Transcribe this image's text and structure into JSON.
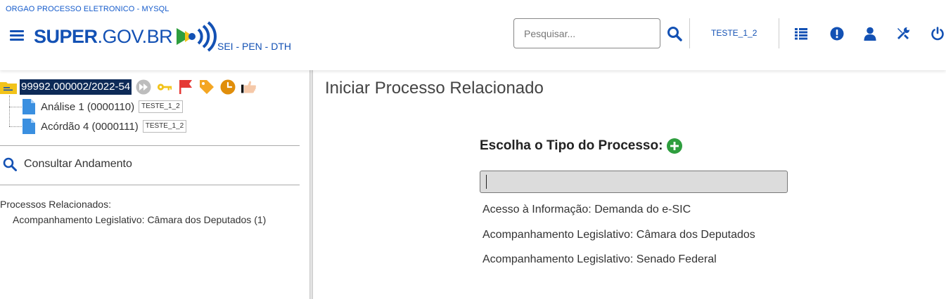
{
  "header": {
    "org_line": "ORGAO PROCESSO ELETRONICO - MYSQL",
    "logo_bold": "SUPER",
    "logo_rest": ".GOV.BR",
    "logo_sub": "SEI - PEN - DTH",
    "search_placeholder": "Pesquisar...",
    "unit": "TESTE_1_2",
    "icons": [
      "menu-icon",
      "search-icon",
      "panel-list-icon",
      "alert-icon",
      "user-icon",
      "tools-icon",
      "power-icon"
    ]
  },
  "tree": {
    "process_number": "99992.000002/2022-54",
    "status_icons": [
      "fast-forward-icon",
      "key-icon",
      "flag-icon",
      "tag-icon",
      "clock-icon",
      "hand-icon"
    ],
    "documents": [
      {
        "label": "Análise 1 (0000110)",
        "tag": "TESTE_1_2"
      },
      {
        "label": "Acórdão 4 (0000111)",
        "tag": "TESTE_1_2"
      }
    ]
  },
  "sidebar": {
    "consult_label": "Consultar Andamento",
    "related_title": "Processos Relacionados:",
    "related_items": [
      "Acompanhamento Legislativo: Câmara dos Deputados (1)"
    ]
  },
  "main": {
    "title": "Iniciar Processo Relacionado",
    "form_label": "Escolha o Tipo do Processo:",
    "input_value": "",
    "options": [
      "Acesso à Informação: Demanda do e-SIC",
      "Acompanhamento Legislativo: Câmara dos Deputados",
      "Acompanhamento Legislativo: Senado Federal"
    ]
  },
  "colors": {
    "brand_blue": "#1351b4",
    "selection_bg": "#0d2a57",
    "add_green": "#2e9e3e",
    "flag_red": "#e53935",
    "key_yellow": "#f2c31a",
    "tag_orange": "#f4a623",
    "clock_orange": "#e08e0b"
  }
}
